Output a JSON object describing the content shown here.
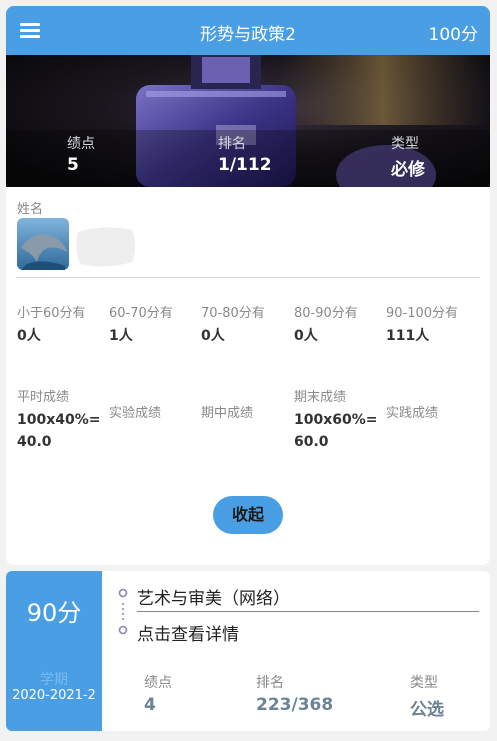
{
  "header": {
    "title": "形势与政策2",
    "score": "100分"
  },
  "banner": {
    "gpa_label": "绩点",
    "gpa_value": "5",
    "rank_label": "排名",
    "rank_value": "1/112",
    "type_label": "类型",
    "type_value": "必修"
  },
  "student": {
    "name_label": "姓名"
  },
  "distribution": [
    {
      "label": "小于60分有",
      "value": "0人"
    },
    {
      "label": "60-70分有",
      "value": "1人"
    },
    {
      "label": "70-80分有",
      "value": "0人"
    },
    {
      "label": "80-90分有",
      "value": "0人"
    },
    {
      "label": "90-100分有",
      "value": "111人"
    }
  ],
  "components": [
    {
      "label": "平时成绩",
      "value": "100x40%=40.0"
    },
    {
      "label": "实验成绩",
      "value": ""
    },
    {
      "label": "期中成绩",
      "value": ""
    },
    {
      "label": "期末成绩",
      "value": "100x60%=60.0"
    },
    {
      "label": "实践成绩",
      "value": ""
    }
  ],
  "collapse_label": "收起",
  "course2": {
    "score": "90分",
    "term_label": "学期",
    "term_value": "2020-2021-2",
    "name": "艺术与审美（网络）",
    "detail_link": "点击查看详情",
    "gpa_label": "绩点",
    "gpa_value": "4",
    "rank_label": "排名",
    "rank_value": "223/368",
    "type_label": "类型",
    "type_value": "公选"
  },
  "colors": {
    "accent": "#4a9fe4",
    "stat_value": "#6b8396"
  },
  "icons": [
    "menu-icon",
    "timeline-dots-icon"
  ]
}
